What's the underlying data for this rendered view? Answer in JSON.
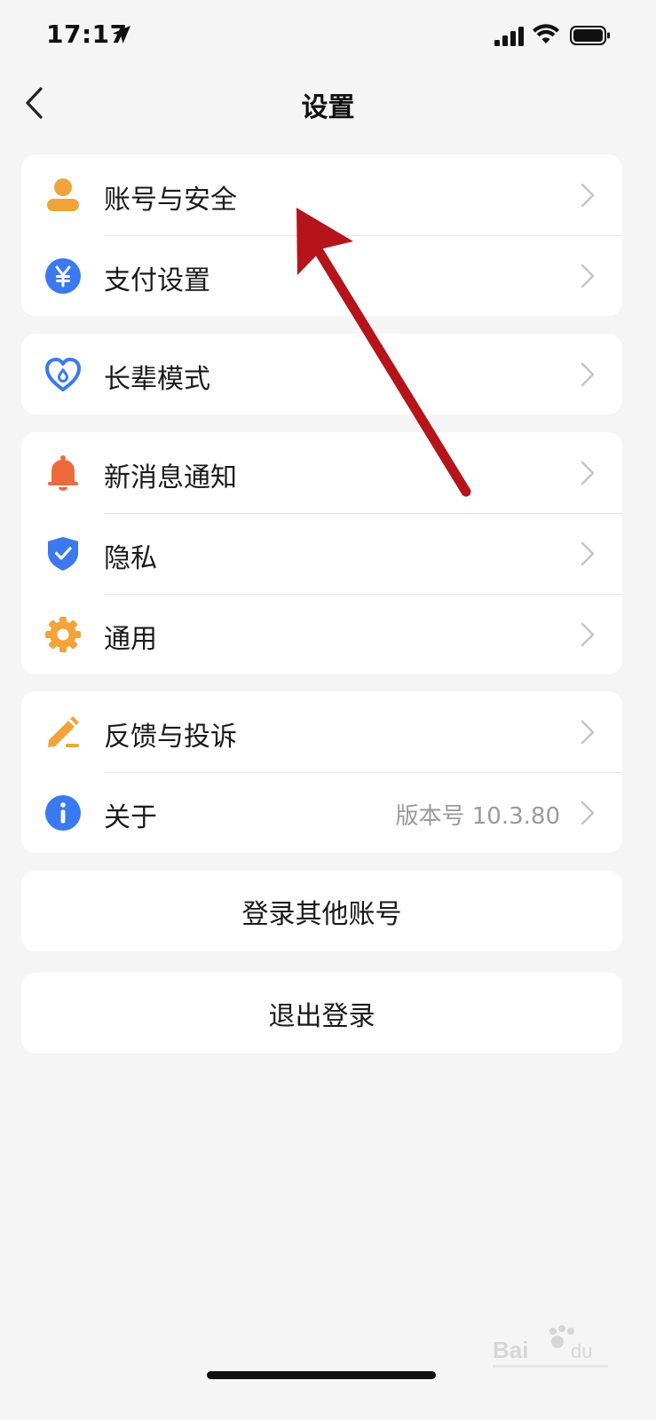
{
  "status_bar": {
    "time": "17:17"
  },
  "nav": {
    "title": "设置"
  },
  "sections": [
    {
      "items": [
        {
          "label": "账号与安全",
          "icon": "person-icon"
        },
        {
          "label": "支付设置",
          "icon": "yuan-icon"
        }
      ]
    },
    {
      "items": [
        {
          "label": "长辈模式",
          "icon": "heart-icon"
        }
      ]
    },
    {
      "items": [
        {
          "label": "新消息通知",
          "icon": "bell-icon"
        },
        {
          "label": "隐私",
          "icon": "shield-icon"
        },
        {
          "label": "通用",
          "icon": "gear-icon"
        }
      ]
    },
    {
      "items": [
        {
          "label": "反馈与投诉",
          "icon": "pen-icon"
        },
        {
          "label": "关于",
          "icon": "info-icon",
          "value": "版本号 10.3.80"
        }
      ]
    }
  ],
  "buttons": {
    "switch_account": "登录其他账号",
    "logout": "退出登录"
  },
  "colors": {
    "background": "#f5f5f5",
    "orange": "#f2a33a",
    "blue": "#3b79f0",
    "red_orange": "#ef6a3a",
    "annotation_red": "#b5141b"
  }
}
